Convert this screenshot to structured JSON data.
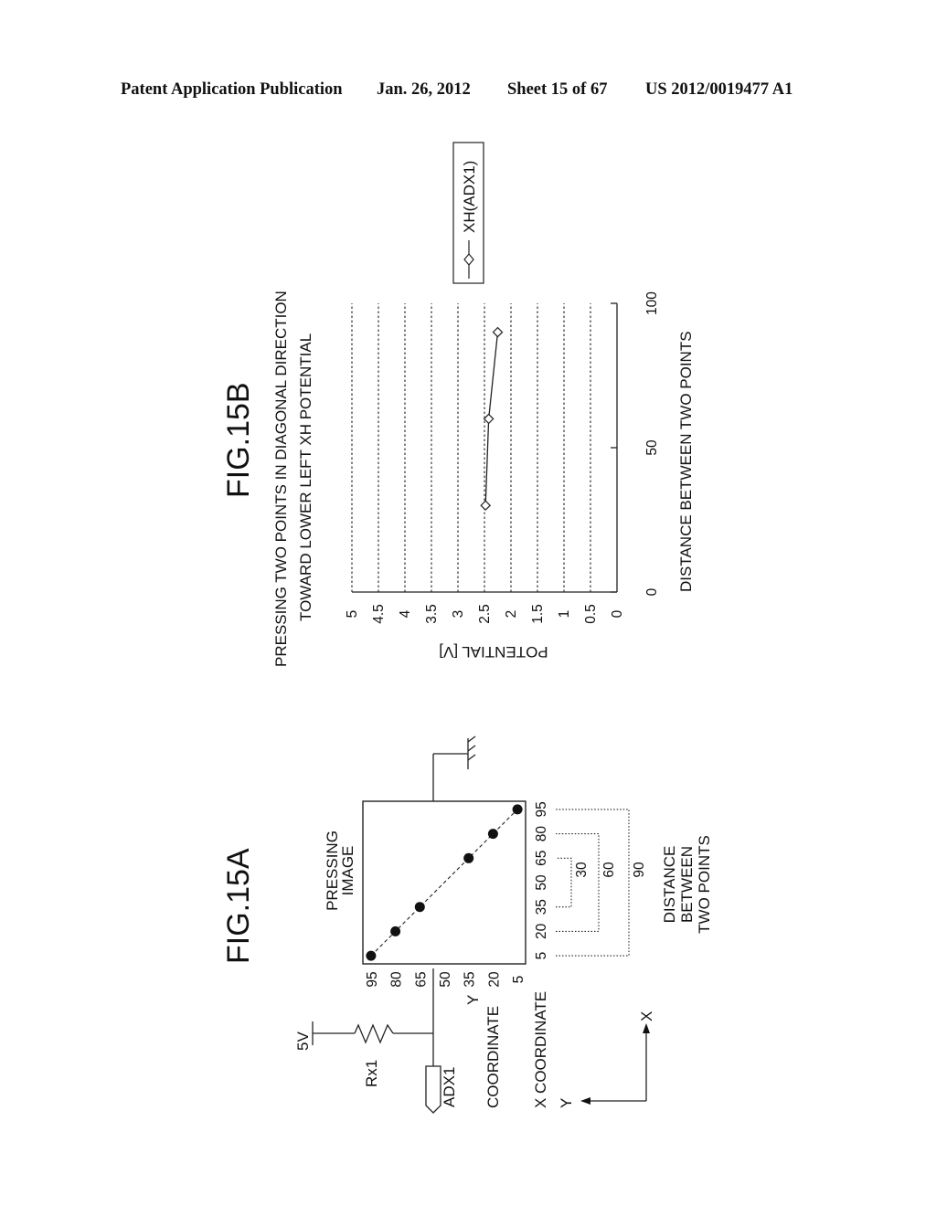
{
  "header": {
    "left": "Patent Application Publication",
    "date": "Jan. 26, 2012",
    "sheet": "Sheet 15 of 67",
    "pub_number": "US 2012/0019477 A1"
  },
  "fig15a": {
    "title": "FIG.15A",
    "pressing_image_label": [
      "PRESSING",
      "IMAGE"
    ],
    "supply_label": "5V",
    "resistor_label": "Rx1",
    "adc_label": "ADX1",
    "y_coord_label": [
      "Y",
      "COORDINATE"
    ],
    "x_coord_label": "X COORDINATE",
    "y_ticks": [
      "95",
      "80",
      "65",
      "50",
      "35",
      "20",
      "5"
    ],
    "x_ticks": [
      "5",
      "20",
      "35",
      "50",
      "65",
      "80",
      "95"
    ],
    "press_points": [
      {
        "x": 5,
        "y": 95
      },
      {
        "x": 20,
        "y": 80
      },
      {
        "x": 35,
        "y": 65
      },
      {
        "x": 65,
        "y": 35
      },
      {
        "x": 80,
        "y": 20
      },
      {
        "x": 95,
        "y": 5
      }
    ],
    "distance_brackets": [
      {
        "from": 35,
        "to": 65,
        "label": "30"
      },
      {
        "from": 20,
        "to": 80,
        "label": "60"
      },
      {
        "from": 5,
        "to": 95,
        "label": "90"
      }
    ],
    "distance_label": [
      "DISTANCE",
      "BETWEEN",
      "TWO POINTS"
    ],
    "axis_arrows": {
      "x": "X",
      "y": "Y"
    }
  },
  "chart_data": {
    "type": "line",
    "figure": "FIG.15B",
    "title": [
      "PRESSING TWO POINTS IN DIAGONAL DIRECTION",
      "TOWARD LOWER LEFT    XH POTENTIAL"
    ],
    "xlabel": "DISTANCE BETWEEN TWO POINTS",
    "ylabel": "POTENTIAL [V]",
    "xlim": [
      0,
      100
    ],
    "ylim": [
      0,
      5
    ],
    "x_ticks": [
      "0",
      "50",
      "100"
    ],
    "y_ticks": [
      "0",
      "0.5",
      "1",
      "1.5",
      "2",
      "2.5",
      "3",
      "3.5",
      "4",
      "4.5",
      "5"
    ],
    "grid": "horizontal dashed",
    "legend": "right",
    "orientation": "rotated 90° counter-clockwise",
    "series": [
      {
        "name": "XH(ADX1)",
        "marker": "diamond",
        "x": [
          30,
          60,
          90
        ],
        "y": [
          2.48,
          2.42,
          2.25
        ]
      }
    ]
  }
}
